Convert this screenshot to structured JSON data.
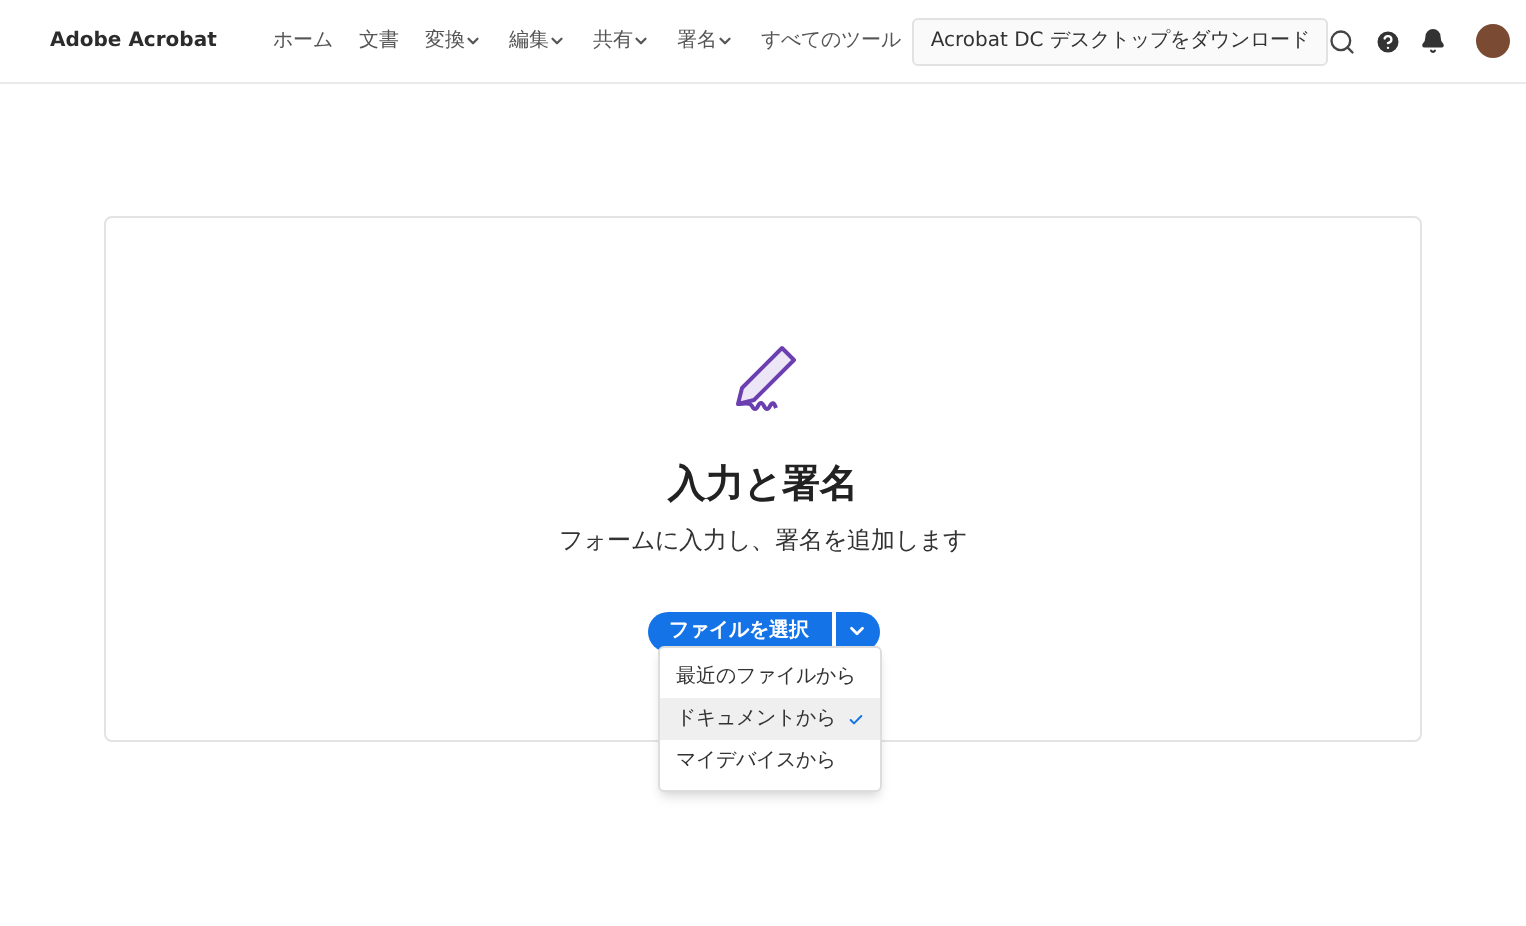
{
  "header": {
    "brand": "Adobe Acrobat",
    "nav": [
      {
        "label": "ホーム",
        "dropdown": false
      },
      {
        "label": "文書",
        "dropdown": false
      },
      {
        "label": "変換",
        "dropdown": true
      },
      {
        "label": "編集",
        "dropdown": true
      },
      {
        "label": "共有",
        "dropdown": true
      },
      {
        "label": "署名",
        "dropdown": true
      },
      {
        "label": "すべてのツール",
        "dropdown": false
      }
    ],
    "download_button": "Acrobat DC デスクトップをダウンロード"
  },
  "card": {
    "title": "入力と署名",
    "subtitle": "フォームに入力し、署名を追加します",
    "select_button": "ファイルを選択",
    "menu": [
      {
        "label": "最近のファイルから",
        "selected": false
      },
      {
        "label": "ドキュメントから",
        "selected": true
      },
      {
        "label": "マイデバイスから",
        "selected": false
      }
    ]
  }
}
